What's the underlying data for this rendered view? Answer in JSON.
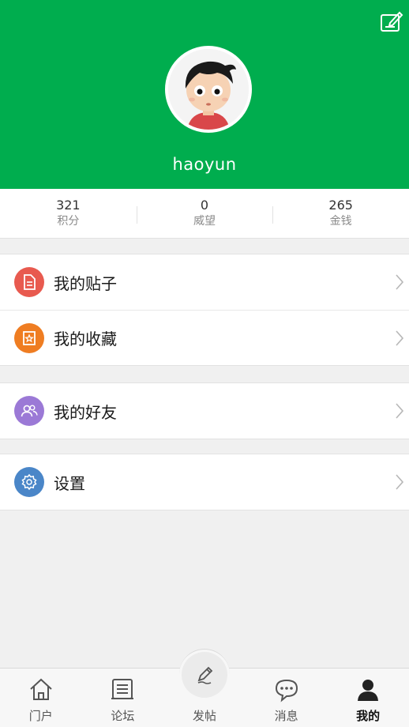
{
  "profile": {
    "username": "haoyun"
  },
  "stats": [
    {
      "value": "321",
      "label": "积分"
    },
    {
      "value": "0",
      "label": "威望"
    },
    {
      "value": "265",
      "label": "金钱"
    }
  ],
  "menu": {
    "posts": {
      "label": "我的贴子",
      "icon": "document-icon",
      "color": "#e85a4f"
    },
    "favorites": {
      "label": "我的收藏",
      "icon": "star-box-icon",
      "color": "#ef7d22"
    },
    "friends": {
      "label": "我的好友",
      "icon": "people-icon",
      "color": "#9b79d6"
    },
    "settings": {
      "label": "设置",
      "icon": "gear-icon",
      "color": "#4a86c8"
    }
  },
  "tabs": [
    {
      "label": "门户",
      "icon": "home-icon"
    },
    {
      "label": "论坛",
      "icon": "forum-icon"
    },
    {
      "label": "发帖",
      "icon": "pen-icon"
    },
    {
      "label": "消息",
      "icon": "chat-icon"
    },
    {
      "label": "我的",
      "icon": "person-icon",
      "active": true
    }
  ],
  "colors": {
    "header": "#00ad4e",
    "background": "#f0f0f0"
  }
}
